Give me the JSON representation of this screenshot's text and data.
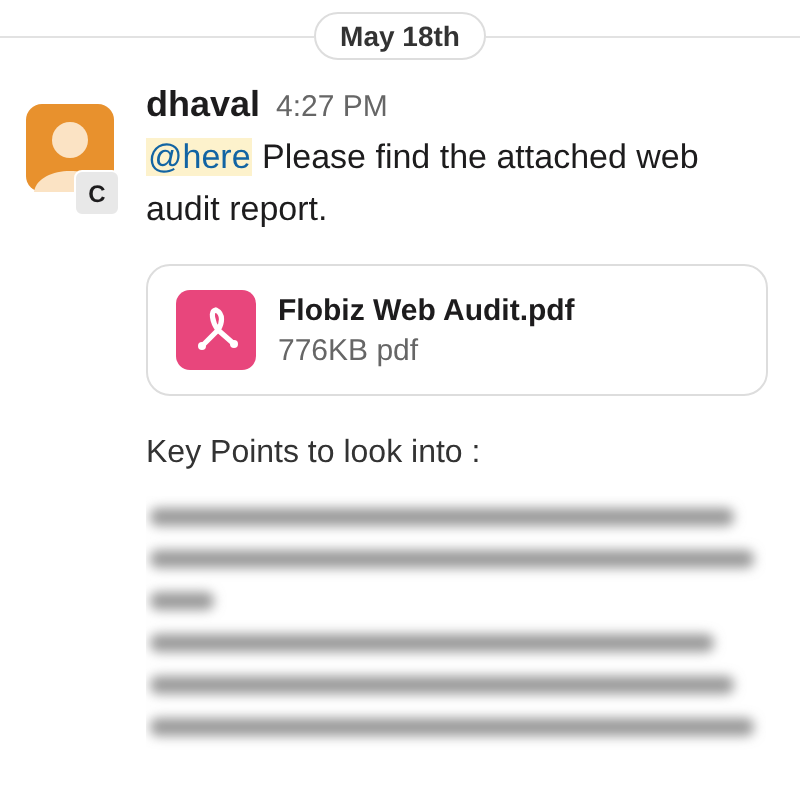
{
  "date_divider": "May 18th",
  "message": {
    "author": "dhaval",
    "time": "4:27 PM",
    "avatar_badge": "C",
    "mention": "@here",
    "body": "Please find the attached web audit report.",
    "attachment": {
      "name": "Flobiz Web Audit.pdf",
      "meta": "776KB pdf"
    },
    "heading": "Key Points to look into :"
  }
}
